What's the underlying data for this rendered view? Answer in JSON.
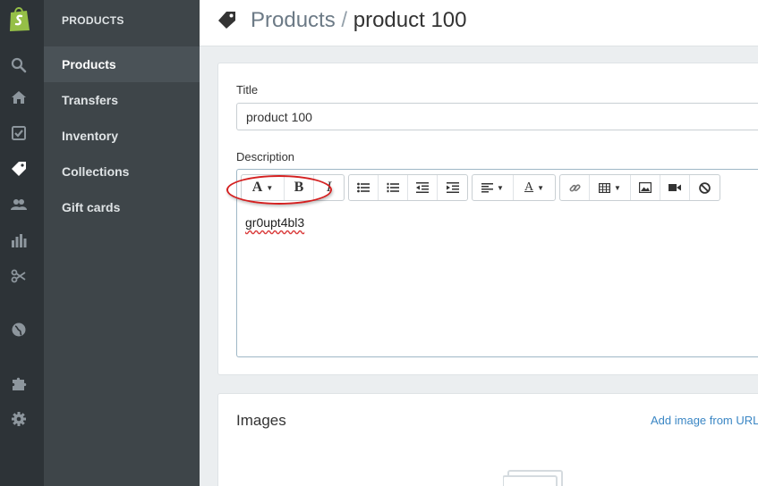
{
  "nav_rail": {
    "logo": "shopify-bag-icon",
    "icons": [
      "search-icon",
      "home-icon",
      "orders-icon",
      "products-tag-icon",
      "customers-icon",
      "reports-icon",
      "discounts-icon",
      "sales-channels-globe-icon",
      "apps-puzzle-icon",
      "settings-gear-icon"
    ],
    "active_icon": "products-tag-icon"
  },
  "subnav": {
    "section_title": "PRODUCTS",
    "items": [
      {
        "label": "Products",
        "active": true
      },
      {
        "label": "Transfers",
        "active": false
      },
      {
        "label": "Inventory",
        "active": false
      },
      {
        "label": "Collections",
        "active": false
      },
      {
        "label": "Gift cards",
        "active": false
      }
    ]
  },
  "header": {
    "icon": "tag-icon",
    "breadcrumb_link": "Products",
    "separator": "/",
    "current": "product 100"
  },
  "form": {
    "title_label": "Title",
    "title_value": "product 100",
    "description_label": "Description",
    "description_value": "gr0upt4bl3",
    "toolbar_icons": [
      "font-icon",
      "bold-icon",
      "italic-icon",
      "bullet-list-icon",
      "numbered-list-icon",
      "outdent-icon",
      "indent-icon",
      "align-left-icon",
      "text-color-icon",
      "link-icon",
      "table-icon",
      "image-icon",
      "video-icon",
      "clear-formatting-icon"
    ]
  },
  "images": {
    "heading": "Images",
    "add_link": "Add image from URL"
  },
  "colors": {
    "rail_bg": "#2d3337",
    "subnav_bg": "#3e4549",
    "subnav_active_bg": "#4a5257",
    "brand_green": "#95bf47",
    "link_blue": "#3a86c4",
    "annotation_red": "#d42020"
  }
}
